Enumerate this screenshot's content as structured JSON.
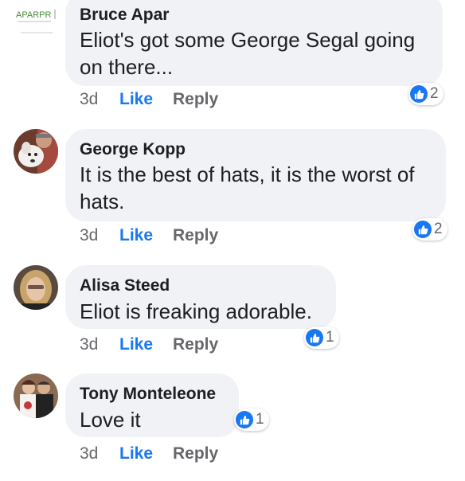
{
  "colors": {
    "like_blue": "#1877f2",
    "bubble_gray": "#f0f2f5",
    "meta_gray": "#65676b"
  },
  "comments": [
    {
      "author": "Bruce Apar",
      "avatar_text": "APARPR",
      "text": "Eliot's got some George Segal going on there...",
      "time": "3d",
      "like_label": "Like",
      "reply_label": "Reply",
      "reaction_icon": "thumbs-up-icon",
      "reaction_count": "2"
    },
    {
      "author": "George Kopp",
      "text": "It is the best of hats, it is the worst of hats.",
      "time": "3d",
      "like_label": "Like",
      "reply_label": "Reply",
      "reaction_icon": "thumbs-up-icon",
      "reaction_count": "2"
    },
    {
      "author": "Alisa Steed",
      "text": "Eliot is freaking adorable.",
      "time": "3d",
      "like_label": "Like",
      "reply_label": "Reply",
      "reaction_icon": "thumbs-up-icon",
      "reaction_count": "1"
    },
    {
      "author": "Tony Monteleone",
      "text": "Love it",
      "time": "3d",
      "like_label": "Like",
      "reply_label": "Reply",
      "reaction_icon": "thumbs-up-icon",
      "reaction_count": "1"
    }
  ]
}
